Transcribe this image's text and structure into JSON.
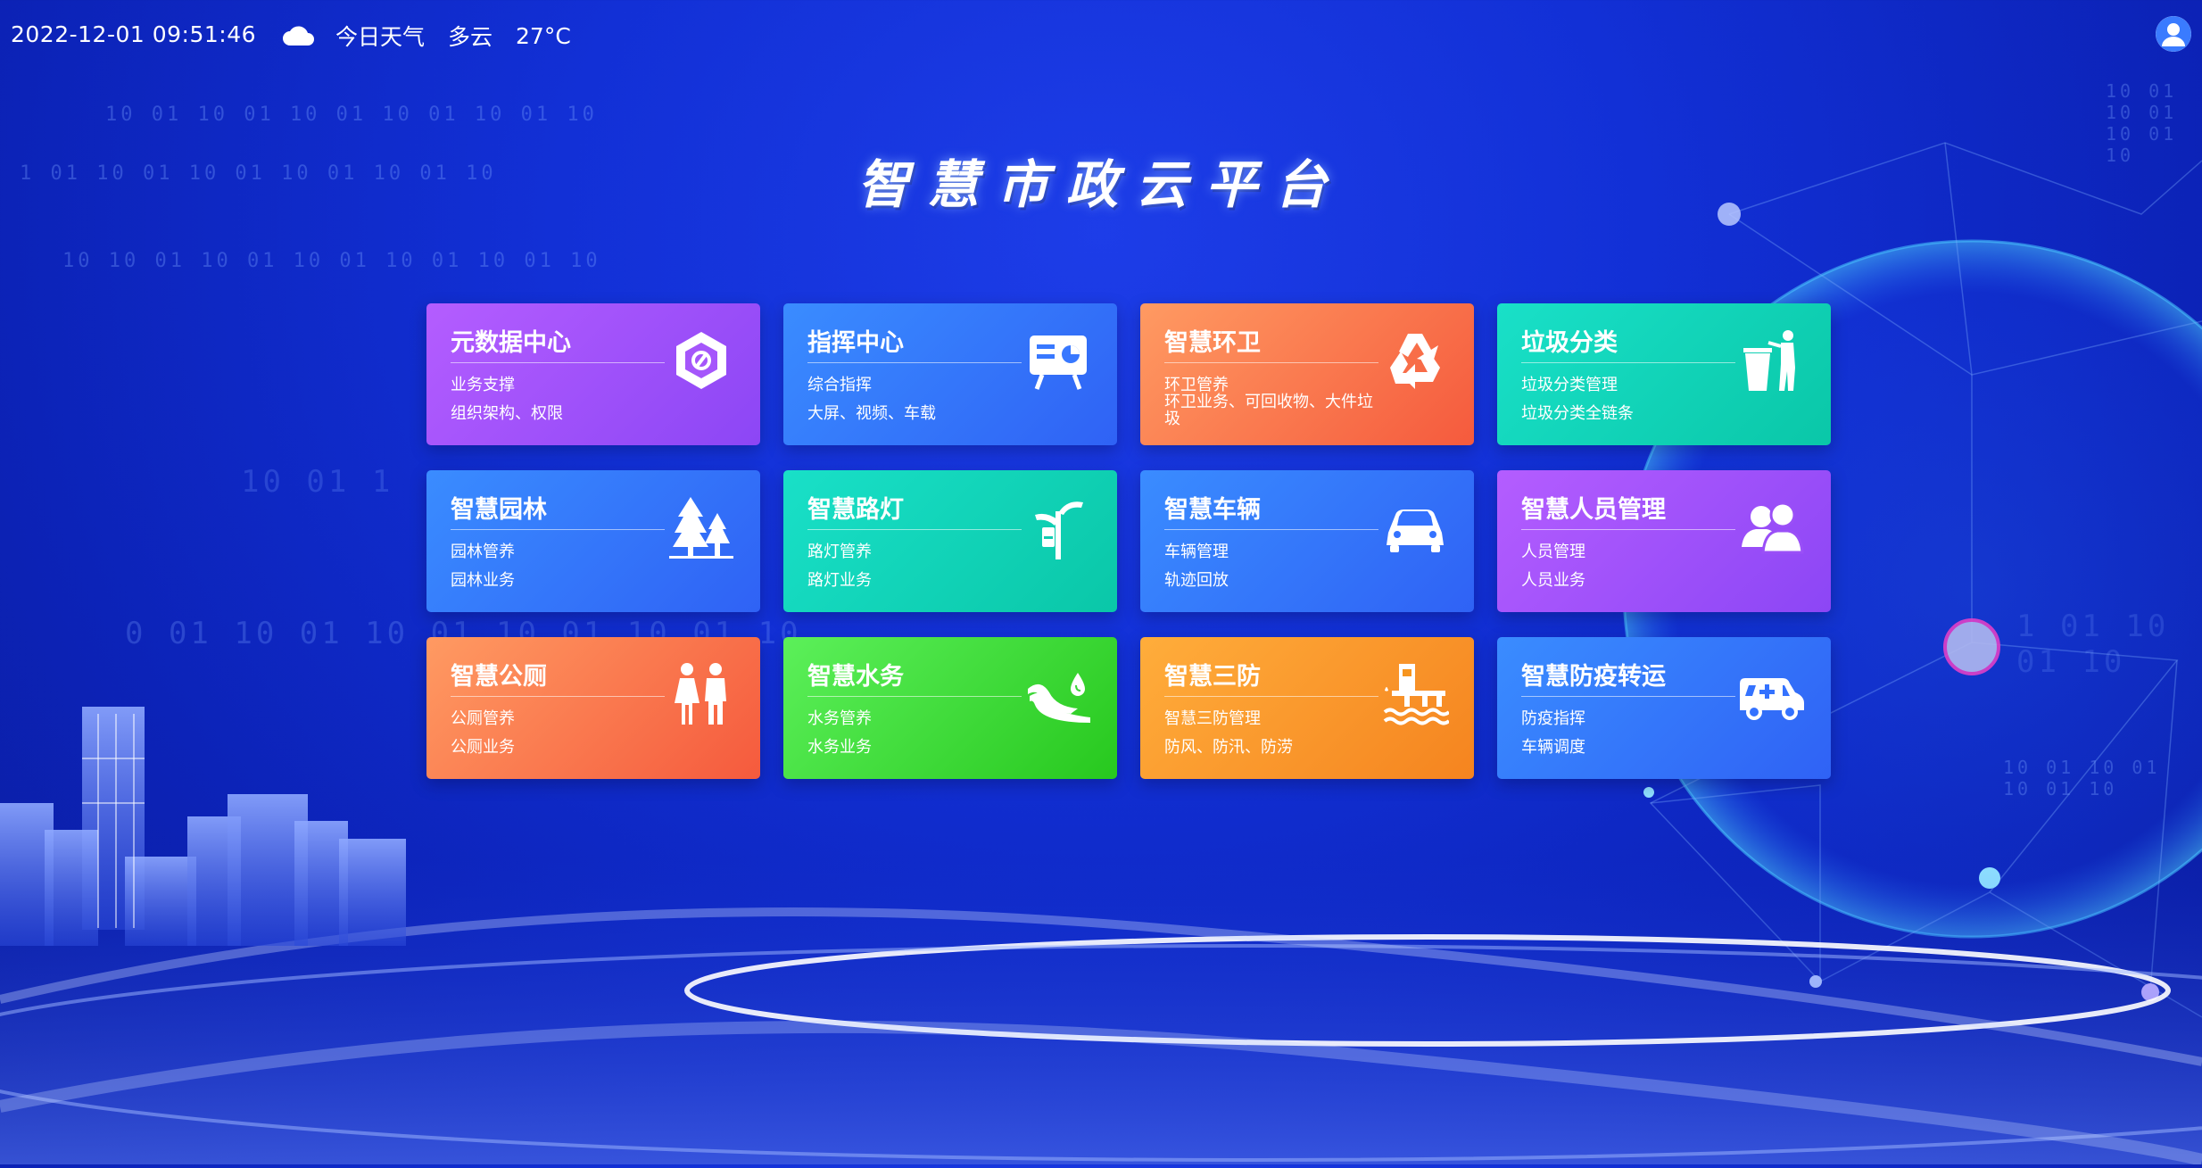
{
  "header": {
    "datetime": "2022-12-01 09:51:46",
    "weather_label": "今日天气",
    "weather_condition": "多云",
    "temperature": "27°C",
    "weather_icon": "cloud-icon",
    "avatar_icon": "user-icon"
  },
  "page_title": "智慧市政云平台",
  "decor": {
    "binary_1": "10 01 10 01 10 01 10 01 10 01 10",
    "binary_2": "1 01 10 01 10 01 10 01 10 01 10",
    "binary_3": "10 10 01 10 01 10 01 10 01 10 01 10",
    "binary_4": "10 01 1",
    "binary_5": "0 01 10 01 10 01 10 01 10 01 10",
    "binary_6": "10 01 10 01 10 01 10",
    "binary_7": "10 01 10 01 10 01 10",
    "binary_8": "1 01 10 01 10"
  },
  "cards": [
    {
      "title": "元数据中心",
      "line1": "业务支撑",
      "line2": "组织架构、权限",
      "icon": "data-cube-icon",
      "theme": "purple"
    },
    {
      "title": "指挥中心",
      "line1": "综合指挥",
      "line2": "大屏、视频、车载",
      "icon": "presentation-board-icon",
      "theme": "blue"
    },
    {
      "title": "智慧环卫",
      "line1": "环卫管养",
      "line2": "环卫业务、可回收物、大件垃圾",
      "icon": "recycle-icon",
      "theme": "orange"
    },
    {
      "title": "垃圾分类",
      "line1": "垃圾分类管理",
      "line2": "垃圾分类全链条",
      "icon": "trash-bin-icon",
      "theme": "teal"
    },
    {
      "title": "智慧园林",
      "line1": "园林管养",
      "line2": "园林业务",
      "icon": "trees-icon",
      "theme": "blue"
    },
    {
      "title": "智慧路灯",
      "line1": "路灯管养",
      "line2": "路灯业务",
      "icon": "street-lamp-icon",
      "theme": "teal"
    },
    {
      "title": "智慧车辆",
      "line1": "车辆管理",
      "line2": "轨迹回放",
      "icon": "car-icon",
      "theme": "blue"
    },
    {
      "title": "智慧人员管理",
      "line1": "人员管理",
      "line2": "人员业务",
      "icon": "people-icon",
      "theme": "purple"
    },
    {
      "title": "智慧公厕",
      "line1": "公厕管养",
      "line2": "公厕业务",
      "icon": "restroom-icon",
      "theme": "orange"
    },
    {
      "title": "智慧水务",
      "line1": "水务管养",
      "line2": "水务业务",
      "icon": "water-drop-icon",
      "theme": "green"
    },
    {
      "title": "智慧三防",
      "line1": "智慧三防管理",
      "line2": "防风、防汛、防涝",
      "icon": "flood-control-icon",
      "theme": "amber"
    },
    {
      "title": "智慧防疫转运",
      "line1": "防疫指挥",
      "line2": "车辆调度",
      "icon": "ambulance-icon",
      "theme": "blue"
    }
  ]
}
